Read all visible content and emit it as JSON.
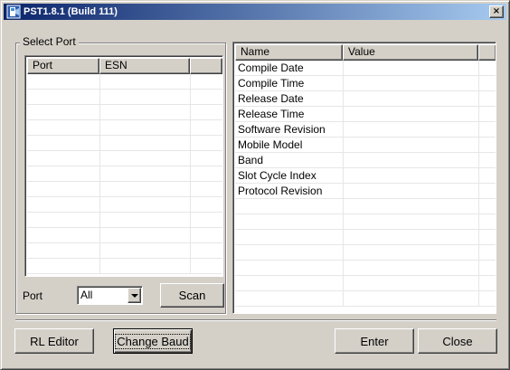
{
  "window": {
    "title": "PST1.8.1 (Build 111)",
    "close_symbol": "×"
  },
  "select_port": {
    "group_label": "Select Port",
    "columns": [
      "Port",
      "ESN"
    ],
    "port_label": "Port",
    "port_filter_value": "All",
    "scan_label": "Scan"
  },
  "info_table": {
    "columns": [
      "Name",
      "Value"
    ],
    "rows": [
      {
        "name": "Compile Date",
        "value": ""
      },
      {
        "name": "Compile Time",
        "value": ""
      },
      {
        "name": "Release Date",
        "value": ""
      },
      {
        "name": "Release Time",
        "value": ""
      },
      {
        "name": "Software Revision",
        "value": ""
      },
      {
        "name": "Mobile Model",
        "value": ""
      },
      {
        "name": "Band",
        "value": ""
      },
      {
        "name": "Slot Cycle Index",
        "value": ""
      },
      {
        "name": "Protocol Revision",
        "value": ""
      }
    ]
  },
  "buttons": {
    "rl_editor": "RL Editor",
    "change_baud": "Change Baud",
    "enter": "Enter",
    "close": "Close"
  },
  "colors": {
    "titlebar_start": "#0a246a",
    "titlebar_end": "#a6caf0",
    "face": "#d4d0c8"
  }
}
